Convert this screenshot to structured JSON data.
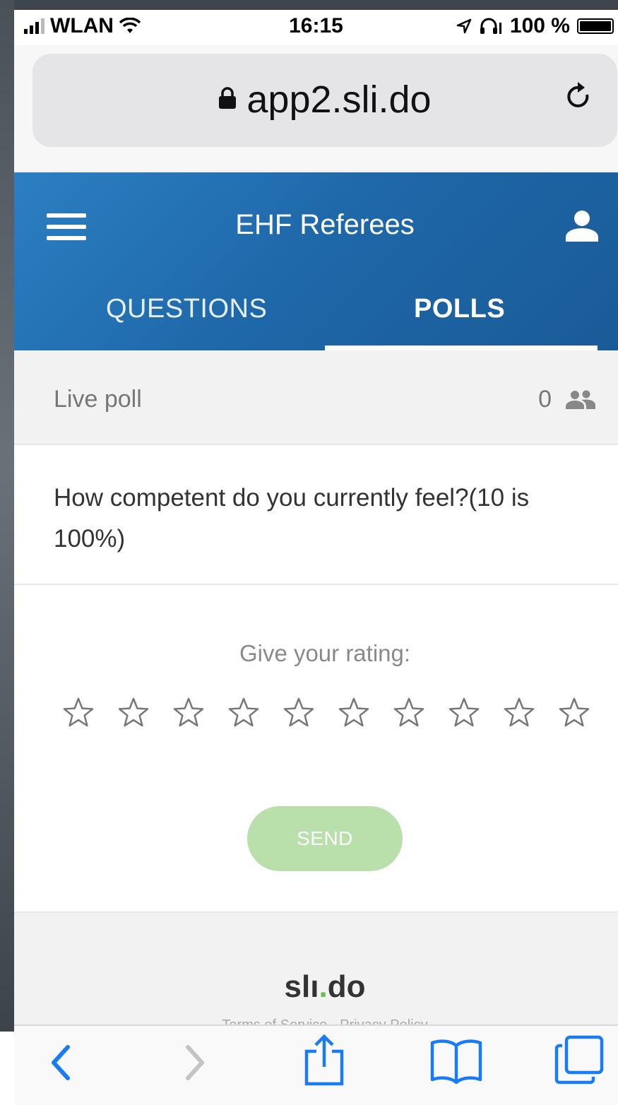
{
  "status_bar": {
    "carrier": "WLAN",
    "time": "16:15",
    "battery": "100 %"
  },
  "browser": {
    "url": "app2.sli.do"
  },
  "app": {
    "title": "EHF Referees",
    "tabs": [
      {
        "label": "QUESTIONS",
        "active": false
      },
      {
        "label": "POLLS",
        "active": true
      }
    ]
  },
  "poll": {
    "header_label": "Live poll",
    "participant_count": "0",
    "question": "How competent do you currently feel?(10 is 100%)",
    "rating_prompt": "Give your rating:",
    "star_count": 10,
    "rating": 0,
    "send_label": "SEND"
  },
  "footer": {
    "brand_prefix": "slı",
    "brand_dot": ".",
    "brand_suffix": "do",
    "links": "Terms of Service · Privacy Policy"
  },
  "colors": {
    "header": "#1e67a8",
    "send_disabled": "#b9dfaa",
    "brand_dot": "#6cbf48",
    "ios_blue": "#1a7cf5"
  },
  "icons": [
    "lock-icon",
    "reload-icon",
    "hamburger-icon",
    "user-icon",
    "participants-icon",
    "star-icon",
    "back-icon",
    "forward-icon",
    "share-icon",
    "bookmarks-icon",
    "tabs-icon",
    "wifi-icon",
    "location-icon",
    "headphones-icon"
  ]
}
